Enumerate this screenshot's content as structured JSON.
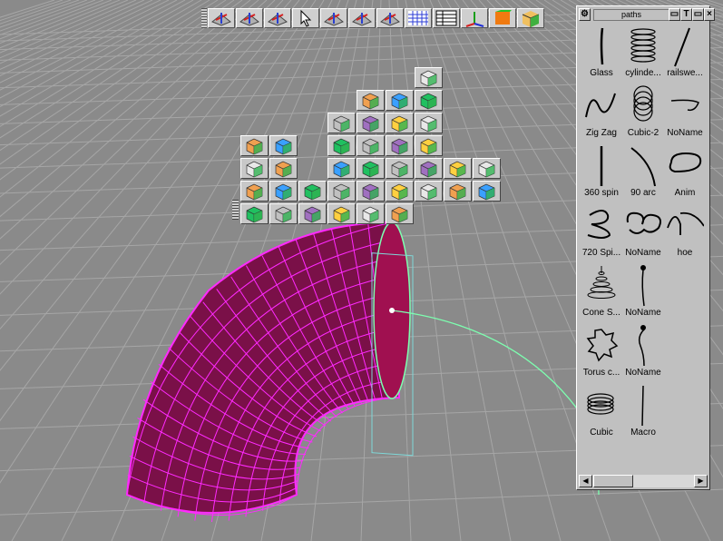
{
  "panel": {
    "title": "paths",
    "items": [
      {
        "label": "Glass",
        "icon": "glass-path-icon"
      },
      {
        "label": "cylinde...",
        "icon": "cylinder-spring-path-icon"
      },
      {
        "label": "railswe...",
        "icon": "rail-sweep-path-icon"
      },
      {
        "label": "Zig Zag",
        "icon": "zig-zag-path-icon"
      },
      {
        "label": "Cubic-2",
        "icon": "cubic-coil-path-icon"
      },
      {
        "label": "NoName",
        "icon": "hook-path-icon"
      },
      {
        "label": "360 spin",
        "icon": "vertical-line-path-icon"
      },
      {
        "label": "90 arc",
        "icon": "arc-path-icon"
      },
      {
        "label": "Anim",
        "icon": "loop-path-icon"
      },
      {
        "label": "720 Spi...",
        "icon": "spiral-path-icon"
      },
      {
        "label": "NoName",
        "icon": "wave-loop-path-icon"
      },
      {
        "label": "hoe",
        "icon": "hoe-path-icon"
      },
      {
        "label": "Cone S...",
        "icon": "cone-spiral-path-icon"
      },
      {
        "label": "NoName",
        "icon": "pin-path-icon"
      },
      {
        "label": "",
        "icon": ""
      },
      {
        "label": "Torus c...",
        "icon": "torus-coil-path-icon"
      },
      {
        "label": "NoName",
        "icon": "curl-path-icon"
      },
      {
        "label": "",
        "icon": ""
      },
      {
        "label": "Cubic",
        "icon": "cubic-spring-path-icon"
      },
      {
        "label": "Macro",
        "icon": "macro-line-path-icon"
      }
    ]
  },
  "colors": {
    "background": "#8a8a8a",
    "grid_line": "#a6a6a6",
    "tube_fill": "#7a1048",
    "tube_wire": "#ff2aff",
    "spline": "#7dffb0",
    "panel": "#c0c0c0"
  },
  "top_toolbar": {
    "buttons": [
      "move-icon",
      "rotate-icon",
      "scale-icon",
      "select-arrow-icon",
      "extrude-icon",
      "rotate-object-icon",
      "scale-object-icon",
      "grid-icon",
      "table-icon",
      "axes-icon",
      "orange-cube-icon",
      "shaded-cube-icon"
    ]
  },
  "palette": {
    "buttons": [
      "mirror-icon",
      "lathe-icon",
      "primitive-sphere-icon",
      "face-icon",
      "cone-icon",
      "mesh-icon",
      "delete-x-icon",
      "box-icon",
      "vase-icon",
      "dome-icon",
      "cube-icon",
      "paint-ball-icon",
      "box2-icon",
      "box3-icon",
      "sweep-icon",
      "knot-icon",
      "box4-icon",
      "box5-icon",
      "sweep-ring-icon",
      "flat-icon",
      "disc-icon",
      "grid-box-icon",
      "star-icon",
      "arch-icon",
      "torus-icon",
      "box6-icon",
      "flat-grid-icon",
      "disc2-icon",
      "box7-icon",
      "flat-box-icon",
      "tube-icon",
      "knife-icon",
      "wood-icon",
      "box8-icon",
      "box9-icon",
      "flat-grid2-icon",
      "disc3-icon"
    ]
  }
}
